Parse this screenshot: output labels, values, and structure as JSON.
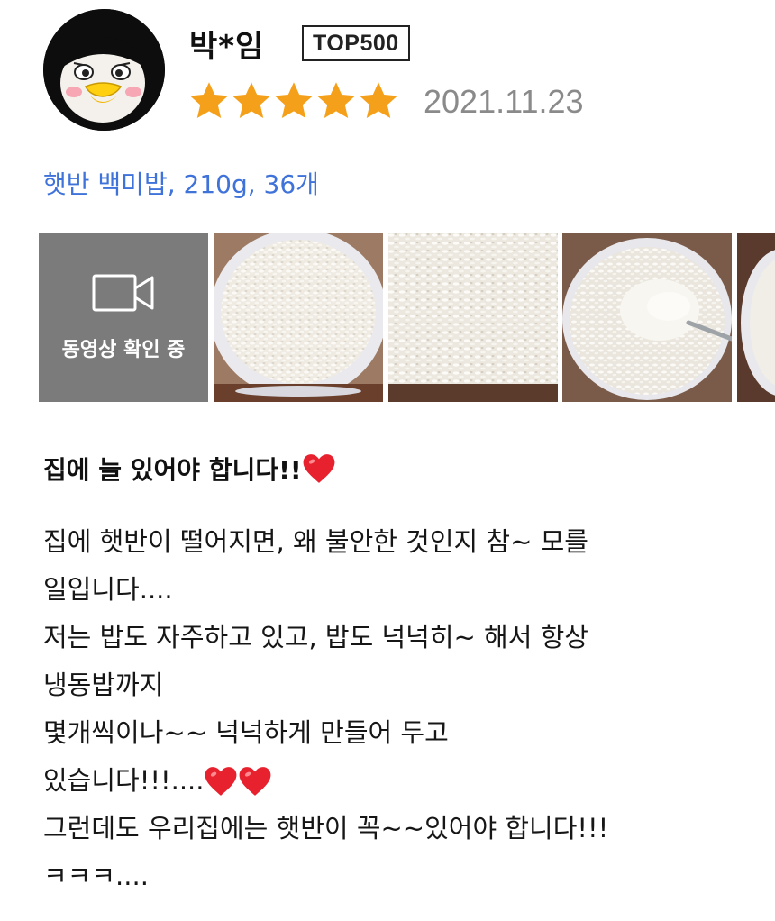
{
  "review": {
    "username": "박*임",
    "badge": "TOP500",
    "rating": 5,
    "date": "2021.11.23",
    "option": "햇반 백미밥, 210g, 36개",
    "video_label": "동영상 확인 중",
    "photo_count": 4,
    "title": "집에 늘 있어야 합니다!!",
    "body": {
      "l1": "집에 햇반이 떨어지면, 왜 불안한 것인지 참~ 모를",
      "l2": "일입니다....",
      "l3": "저는 밥도 자주하고 있고, 밥도 넉넉히~ 해서 항상",
      "l4": "냉동밥까지",
      "l5": "몇개씩이나~~ 넉넉하게  만들어 두고",
      "l6": "있습니다!!!....",
      "l7": "그런데도 우리집에는 햇반이 꼭~~있어야 합니다!!!",
      "l8": "ㅋㅋㅋ...."
    }
  },
  "icons": {
    "star": "star-icon",
    "video": "video-camera-icon",
    "heart": "red-heart-icon"
  },
  "colors": {
    "star": "#f5a01a",
    "option_link": "#3f73d9",
    "date": "#8a8a8a",
    "video_tile": "#7b7b7b",
    "heart": "#e8212e"
  }
}
